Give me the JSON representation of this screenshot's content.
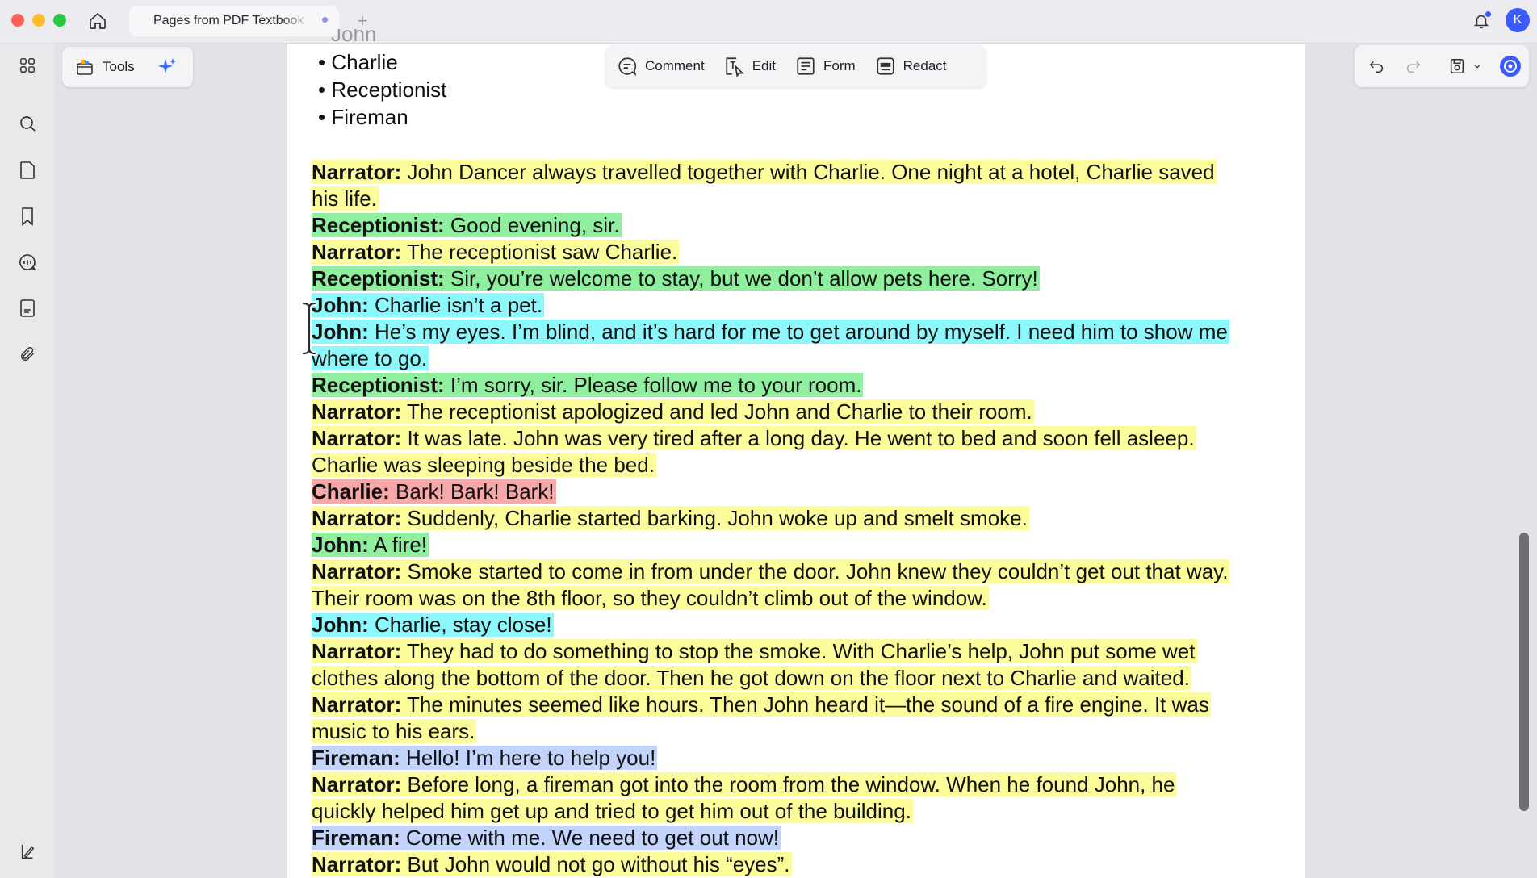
{
  "tab": {
    "title": "Pages from PDF Textbook"
  },
  "avatar": {
    "initial": "K"
  },
  "tools": {
    "label": "Tools"
  },
  "toolbar": {
    "comment": "Comment",
    "edit": "Edit",
    "form": "Form",
    "redact": "Redact"
  },
  "characters": {
    "partial": "John",
    "items": [
      "Charlie",
      "Receptionist",
      "Fireman"
    ]
  },
  "script": [
    {
      "speaker": "Narrator:",
      "text": " John Dancer always travelled together with Charlie. One night at a hotel, Charlie saved",
      "color": "y"
    },
    {
      "speaker": "",
      "text": "his life.",
      "color": "y"
    },
    {
      "speaker": "Receptionist:",
      "text": " Good evening, sir.",
      "color": "g"
    },
    {
      "speaker": "Narrator:",
      "text": " The receptionist saw Charlie.",
      "color": "y"
    },
    {
      "speaker": "Receptionist:",
      "text": " Sir, you’re welcome to stay, but we don’t allow pets here. Sorry!",
      "color": "g"
    },
    {
      "speaker": "John:",
      "text": " Charlie isn’t a pet.",
      "color": "c"
    },
    {
      "speaker": "John:",
      "text": " He’s my eyes. I’m blind, and it’s hard for me to get around by myself. I need him to show me",
      "color": "c"
    },
    {
      "speaker": "",
      "text": "where to go.",
      "color": "c"
    },
    {
      "speaker": "Receptionist:",
      "text": " I’m sorry, sir. Please follow me to your room.",
      "color": "g"
    },
    {
      "speaker": "Narrator:",
      "text": " The receptionist apologized and led John and Charlie to their room.",
      "color": "y"
    },
    {
      "speaker": "Narrator:",
      "text": " It was late. John was very tired after a long day. He went to bed and soon fell asleep.",
      "color": "y"
    },
    {
      "speaker": "",
      "text": "Charlie was sleeping beside the bed.",
      "color": "y"
    },
    {
      "speaker": "Charlie:",
      "text": " Bark! Bark! Bark!",
      "color": "r"
    },
    {
      "speaker": "Narrator:",
      "text": " Suddenly, Charlie started barking. John woke up and smelt smoke.",
      "color": "y"
    },
    {
      "speaker": "John:",
      "text": " A fire!",
      "color": "g"
    },
    {
      "speaker": "Narrator:",
      "text": " Smoke started to come in from under the door. John knew they couldn’t get out that way.",
      "color": "y"
    },
    {
      "speaker": "",
      "text": "Their room was on the 8th floor, so they couldn’t climb out of the window.",
      "color": "y"
    },
    {
      "speaker": "John:",
      "text": " Charlie, stay close!",
      "color": "c"
    },
    {
      "speaker": "Narrator:",
      "text": " They had to do something to stop the smoke. With Charlie’s help, John put some wet",
      "color": "y"
    },
    {
      "speaker": "",
      "text": "clothes along the bottom of the door. Then he got down on the floor next to Charlie and waited.",
      "color": "y"
    },
    {
      "speaker": "Narrator:",
      "text": " The minutes seemed like hours. Then John heard it—the sound of a fire engine. It was",
      "color": "y"
    },
    {
      "speaker": "",
      "text": "music to his ears.",
      "color": "y"
    },
    {
      "speaker": "Fireman:",
      "text": " Hello! I’m here to help you!",
      "color": "b"
    },
    {
      "speaker": "Narrator:",
      "text": " Before long, a fireman got into the room from the window. When he found John, he",
      "color": "y"
    },
    {
      "speaker": "",
      "text": "quickly helped him get up and tried to get him out of the building.",
      "color": "y"
    },
    {
      "speaker": "Fireman:",
      "text": " Come with me. We need to get out now!",
      "color": "b"
    },
    {
      "speaker": "Narrator:",
      "text": " But John would not go without his “eyes”.",
      "color": "y"
    }
  ],
  "colors": {
    "yellow": "#fdfc9a",
    "green": "#8fef9e",
    "cyan": "#8df8fb",
    "red": "#f7a8a8",
    "blue": "#c2d3fc",
    "accent": "#3b5bfd"
  }
}
